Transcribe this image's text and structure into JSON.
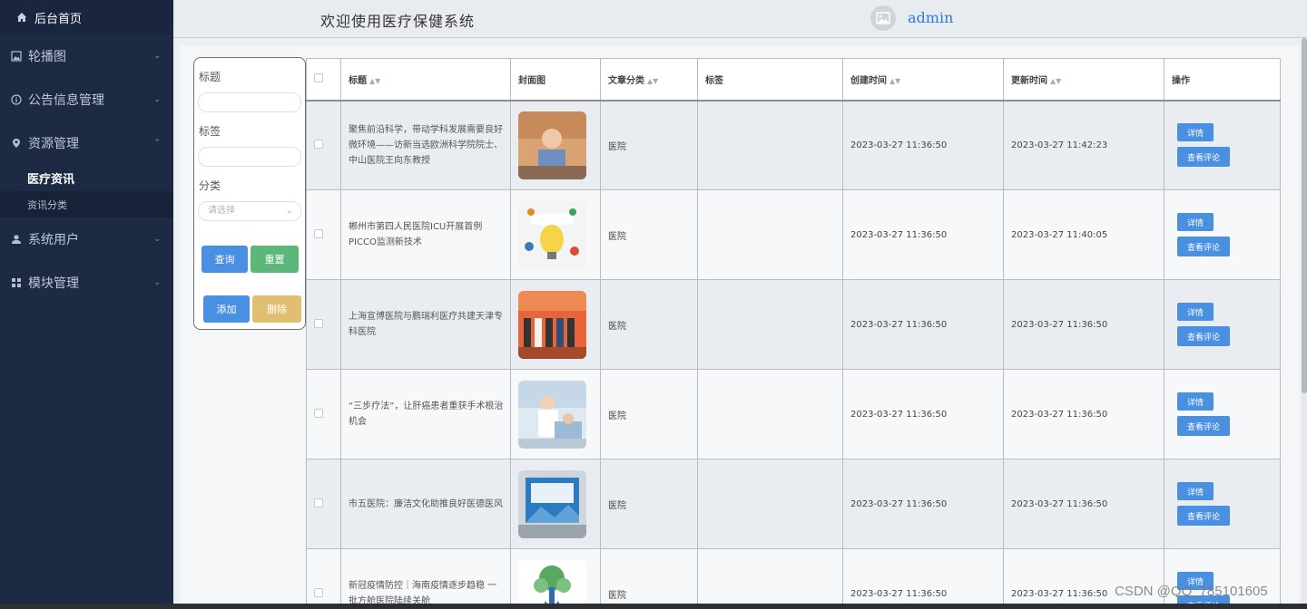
{
  "sidebar": {
    "home": "后台首页",
    "menus": [
      {
        "label": "轮播图",
        "icon": "picture-icon"
      },
      {
        "label": "公告信息管理",
        "icon": "info-circle-icon"
      },
      {
        "label": "资源管理",
        "icon": "location-pin-icon"
      }
    ],
    "submenus": [
      {
        "label": "医疗资讯"
      },
      {
        "label": "资讯分类"
      }
    ],
    "menus2": [
      {
        "label": "系统用户",
        "icon": "user-icon"
      },
      {
        "label": "模块管理",
        "icon": "grid-icon"
      }
    ]
  },
  "header": {
    "welcome": "欢迎使用医疗保健系统",
    "username": "admin"
  },
  "filter": {
    "title_label": "标题",
    "tag_label": "标签",
    "category_label": "分类",
    "category_placeholder": "请选择",
    "search_btn": "查询",
    "reset_btn": "重置",
    "add_btn": "添加",
    "delete_btn": "删除"
  },
  "table": {
    "headers": {
      "title": "标题",
      "cover": "封面图",
      "category": "文章分类",
      "tags": "标签",
      "created": "创建时间",
      "updated": "更新时间",
      "actions": "操作"
    },
    "detail_label": "详情",
    "comment_label": "查看评论",
    "rows": [
      {
        "title": "聚焦前沿科学，带动学科发展需要良好微环境——访新当选欧洲科学院院士、中山医院王向东教授",
        "category": "医院",
        "tags": "",
        "created": "2023-03-27 11:36:50",
        "updated": "2023-03-27 11:42:23"
      },
      {
        "title": "郴州市第四人民医院ICU开展首例PICCO监测新技术",
        "category": "医院",
        "tags": "",
        "created": "2023-03-27 11:36:50",
        "updated": "2023-03-27 11:40:05"
      },
      {
        "title": "上海宣博医院与鹏瑞利医疗共建天津专科医院",
        "category": "医院",
        "tags": "",
        "created": "2023-03-27 11:36:50",
        "updated": "2023-03-27 11:36:50"
      },
      {
        "title": "“三步疗法”，让肝癌患者重获手术根治机会",
        "category": "医院",
        "tags": "",
        "created": "2023-03-27 11:36:50",
        "updated": "2023-03-27 11:36:50"
      },
      {
        "title": "市五医院：廉洁文化助推良好医德医风",
        "category": "医院",
        "tags": "",
        "created": "2023-03-27 11:36:50",
        "updated": "2023-03-27 11:36:50"
      },
      {
        "title": "新冠疫情防控｜海南疫情逐步趋稳 一批方舱医院陆续关舱",
        "category": "医院",
        "tags": "",
        "created": "2023-03-27 11:36:50",
        "updated": "2023-03-27 11:36:50"
      }
    ]
  },
  "watermark": "CSDN @QQ_785101605"
}
